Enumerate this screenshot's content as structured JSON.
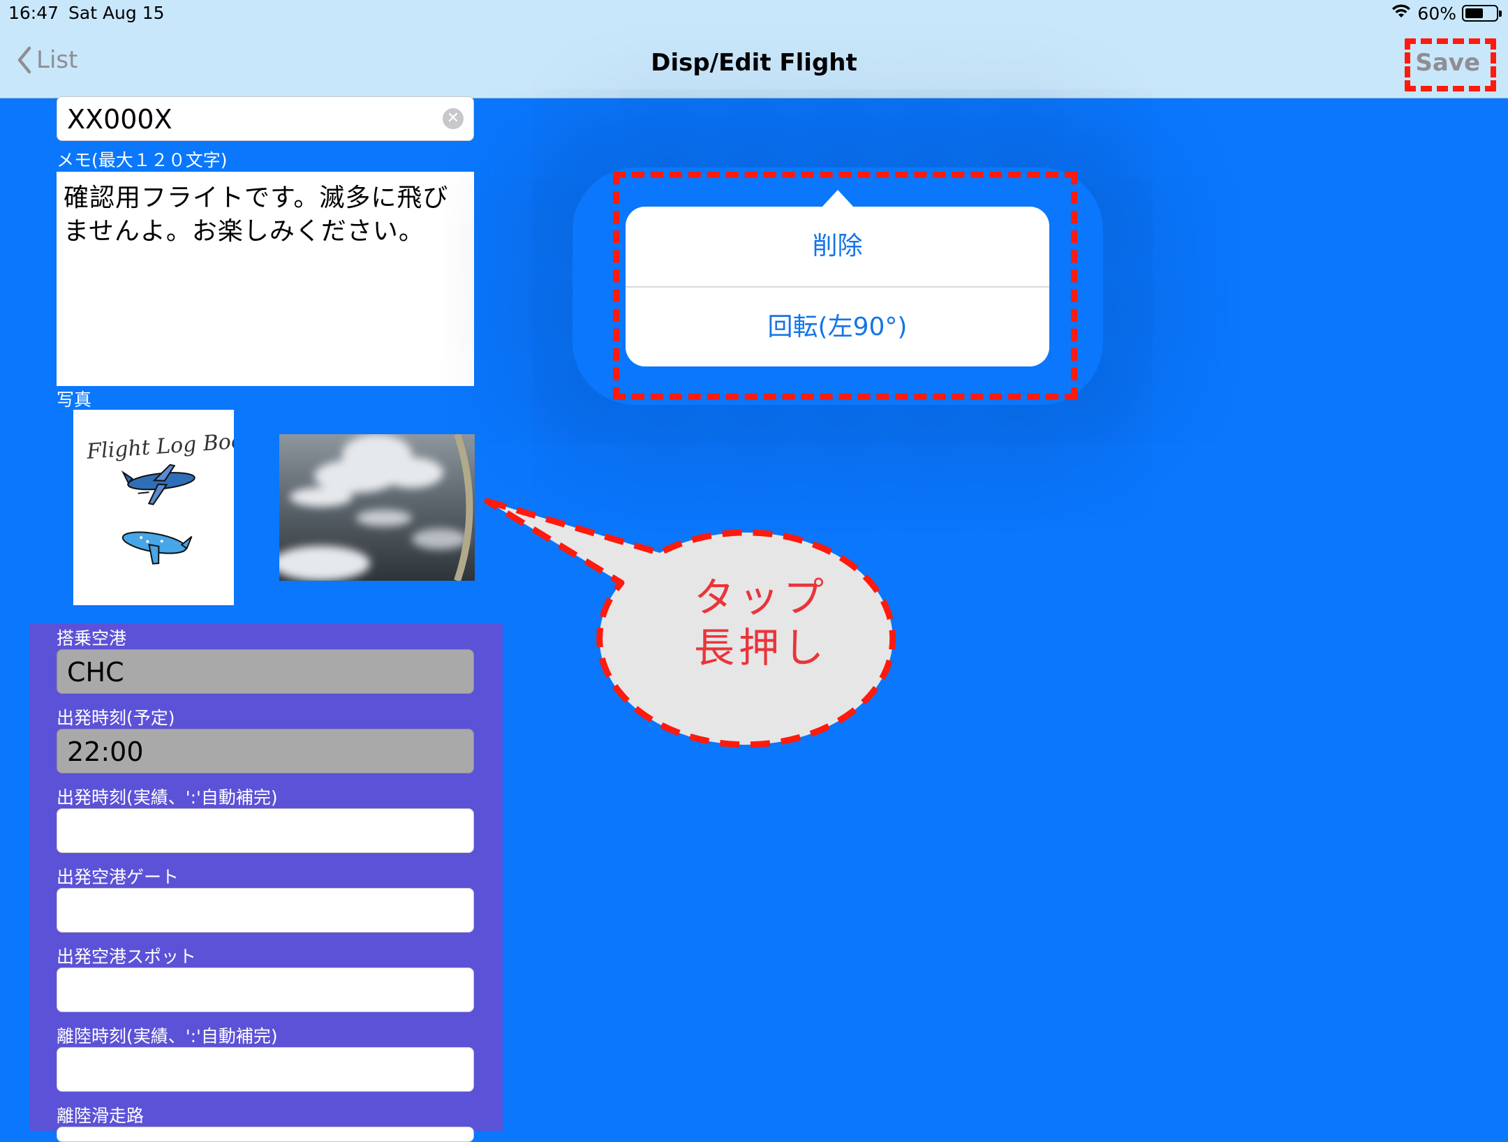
{
  "status_bar": {
    "time": "16:47",
    "date": "Sat Aug 15",
    "battery": "60%",
    "battery_level": 0.6
  },
  "nav": {
    "back_label": "List",
    "title": "Disp/Edit Flight",
    "save_label": "Save"
  },
  "form": {
    "flight_number": "XX000X",
    "memo_label": "メモ(最大１２０文字)",
    "memo_line1": "確認用フライトです。滅多に飛び",
    "memo_line2": "ませんよ。お楽しみください。",
    "photo_label": "写真",
    "photo_handwriting": "Flight Log Book",
    "boarding_airport_label": "搭乗空港",
    "boarding_airport_value": "CHC",
    "departure_scheduled_label": "出発時刻(予定)",
    "departure_scheduled_value": "22:00",
    "departure_actual_label": "出発時刻(実績、':'自動補完)",
    "departure_gate_label": "出発空港ゲート",
    "departure_spot_label": "出発空港スポット",
    "takeoff_actual_label": "離陸時刻(実績、':'自動補完)",
    "takeoff_runway_label": "離陸滑走路"
  },
  "popover": {
    "items": [
      "削除",
      "回転(左90°)"
    ]
  },
  "callout": {
    "line1": "タップ",
    "line2": "長押し"
  },
  "colors": {
    "background": "#0A77FC",
    "nav_bar": "#C9E7FA",
    "panel": "#5C52D7",
    "highlight": "#FF1A0E",
    "menu_text": "#1475E6",
    "callout_text": "#E8353A"
  }
}
